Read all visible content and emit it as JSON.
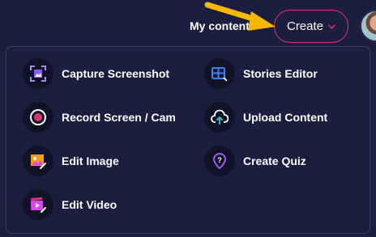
{
  "header": {
    "my_content_label": "My content",
    "create_label": "Create"
  },
  "menu": {
    "items": [
      {
        "label": "Capture Screenshot",
        "icon": "capture-screenshot-icon"
      },
      {
        "label": "Stories Editor",
        "icon": "stories-editor-icon"
      },
      {
        "label": "Record Screen / Cam",
        "icon": "record-icon"
      },
      {
        "label": "Upload Content",
        "icon": "upload-cloud-icon"
      },
      {
        "label": "Edit Image",
        "icon": "edit-image-icon"
      },
      {
        "label": "Create Quiz",
        "icon": "quiz-icon"
      },
      {
        "label": "Edit Video",
        "icon": "edit-video-icon"
      }
    ]
  },
  "colors": {
    "background": "#1b1e3f",
    "accent_pink": "#e0326f",
    "accent_purple": "#8b5cf6",
    "arrow_yellow": "#f5b800"
  }
}
